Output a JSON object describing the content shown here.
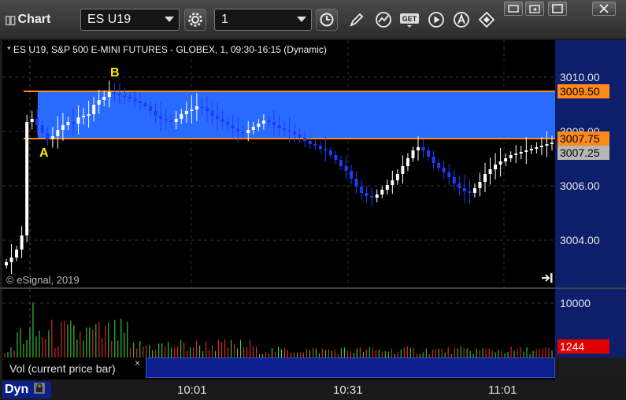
{
  "toolbar": {
    "title": "Chart",
    "symbol": "ES U19",
    "interval": "1"
  },
  "chart": {
    "description": "* ES U19, S&P 500 E-MINI FUTURES - GLOBEX, 1, 09:30-16:15 (Dynamic)",
    "copyright": "© eSignal, 2019",
    "price_labels": [
      "3010.00",
      "3008.00",
      "3006.00",
      "3004.00"
    ],
    "price_tags": {
      "upper_line": "3009.50",
      "lower_line": "3007.75",
      "last_price": "3007.25"
    },
    "markers": {
      "a": "A",
      "b": "B"
    },
    "colors": {
      "zone": "#2a6bff",
      "line": "#ff8a1c",
      "up_bar": "#ffffff",
      "down_bar": "#1e3cff",
      "marker": "#ffee00"
    }
  },
  "volume": {
    "label": "Vol (current price bar)",
    "close_glyph": "×",
    "scale_label": "10000",
    "current_value": "1244"
  },
  "time_axis": {
    "mode": "Dyn",
    "labels": [
      "10:01",
      "10:31",
      "11:01"
    ]
  }
}
